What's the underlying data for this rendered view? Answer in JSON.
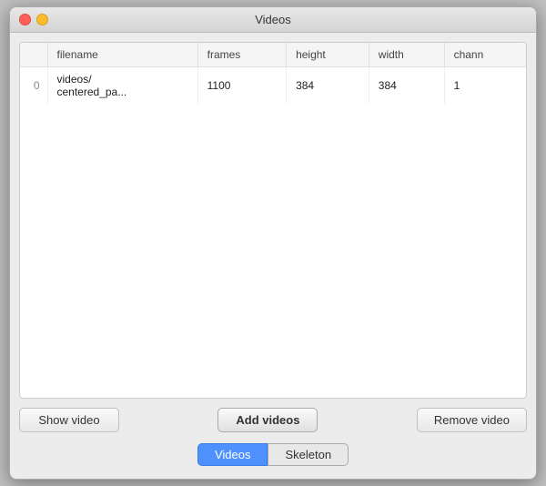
{
  "window": {
    "title": "Videos",
    "controls": {
      "close_label": "✕",
      "minimize_label": "−"
    }
  },
  "table": {
    "columns": [
      {
        "id": "index",
        "label": ""
      },
      {
        "id": "filename",
        "label": "filename"
      },
      {
        "id": "frames",
        "label": "frames"
      },
      {
        "id": "height",
        "label": "height"
      },
      {
        "id": "width",
        "label": "width"
      },
      {
        "id": "channels",
        "label": "chann"
      }
    ],
    "rows": [
      {
        "index": "0",
        "filename": "videos/\ncentered_pa...",
        "frames": "1100",
        "height": "384",
        "width": "384",
        "channels": "1"
      }
    ]
  },
  "buttons": {
    "show_video": "Show video",
    "add_videos": "Add videos",
    "remove_video": "Remove video"
  },
  "tabs": [
    {
      "id": "videos",
      "label": "Videos",
      "active": true
    },
    {
      "id": "skeleton",
      "label": "Skeleton",
      "active": false
    }
  ]
}
